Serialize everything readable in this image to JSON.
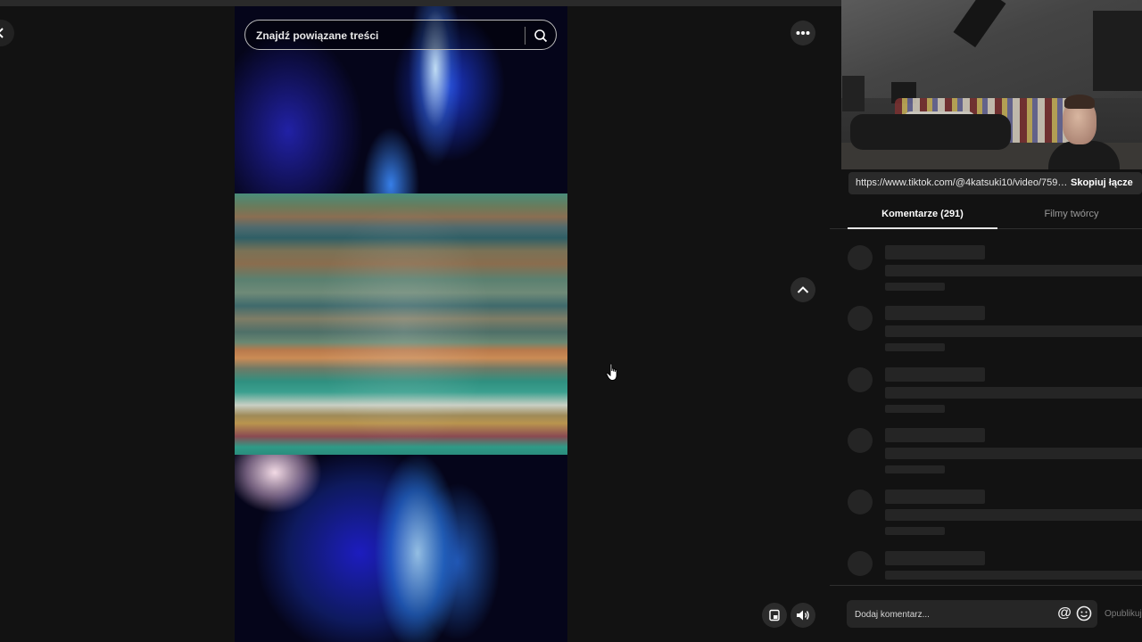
{
  "search": {
    "placeholder": "Znajdź powiązane treści"
  },
  "link": {
    "url": "https://www.tiktok.com/@4katsuki10/video/759497...",
    "copy_label": "Skopiuj łącze"
  },
  "tabs": [
    {
      "label": "Komentarze (291)",
      "active": true
    },
    {
      "label": "Filmy twórcy",
      "active": false
    }
  ],
  "comments": {
    "loading_placeholders": 6
  },
  "comment_box": {
    "placeholder": "Dodaj komentarz...",
    "publish_label": "Opublikuj"
  },
  "icons": {
    "back": "chevron-left-icon",
    "more": "more-horizontal-icon",
    "search": "search-icon",
    "scroll_up": "chevron-up-icon",
    "floating_player": "floating-player-icon",
    "volume": "volume-icon",
    "mention": "at-sign-icon",
    "emoji": "emoji-icon",
    "cursor": "hand-cursor-icon"
  }
}
